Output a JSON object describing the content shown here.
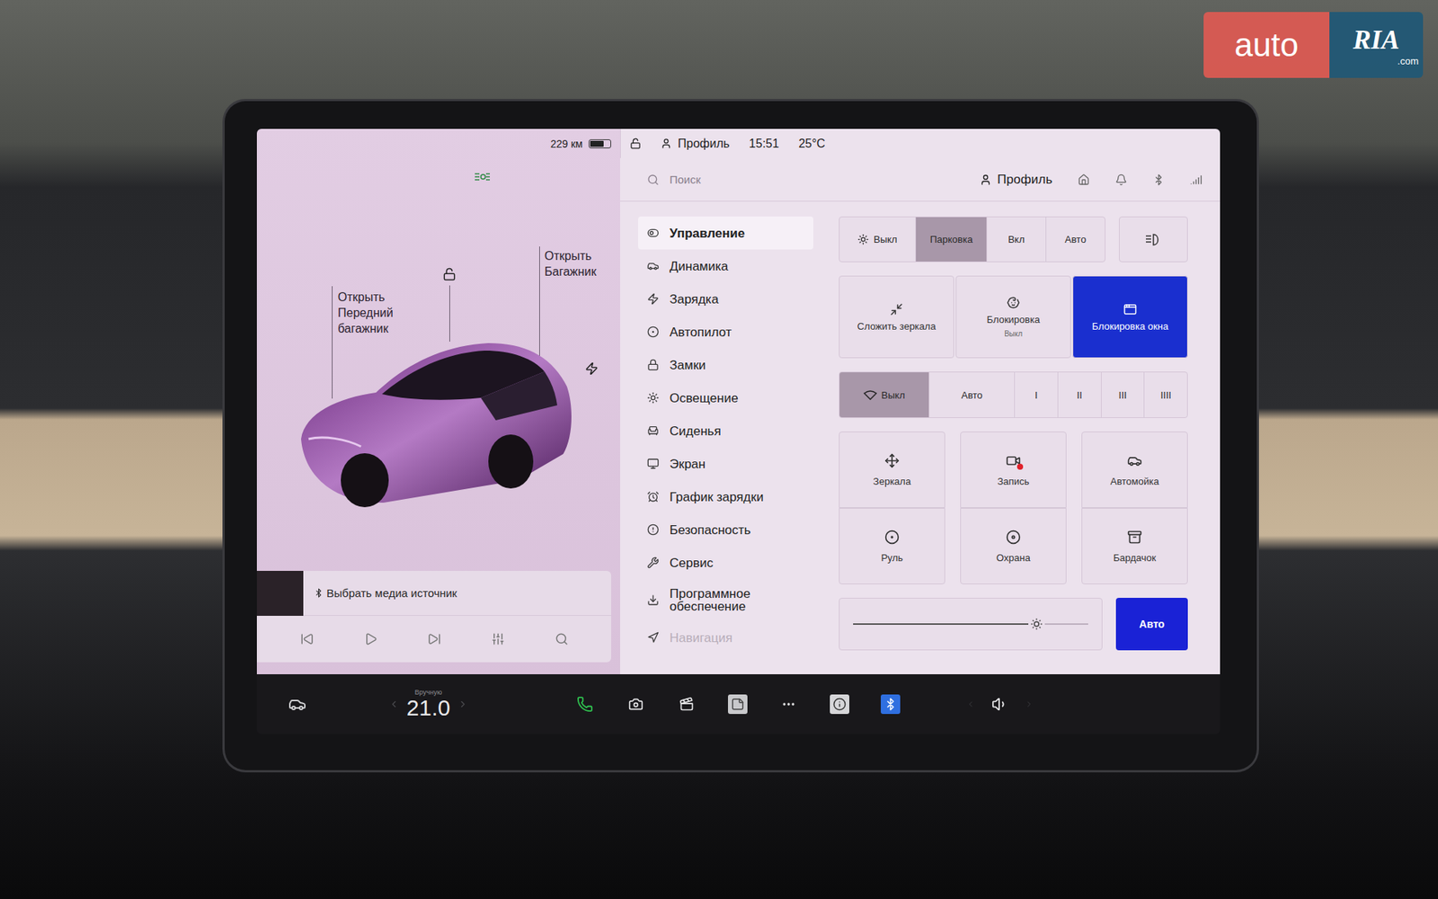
{
  "watermark": {
    "brand": "auto",
    "sub": "RIA",
    "domain": ".com"
  },
  "status_bar": {
    "range": "229 км",
    "battery_level": 0.7,
    "locked": false,
    "profile": "Профиль",
    "time": "15:51",
    "temperature": "25°C"
  },
  "car_view": {
    "front_trunk": [
      "Открыть",
      "Передний",
      "багажник"
    ],
    "trunk": [
      "Открыть",
      "Багажник"
    ],
    "locked": false
  },
  "media": {
    "source": "Выбрать медиа источник"
  },
  "search": {
    "placeholder": "Поиск",
    "profile": "Профиль"
  },
  "menu": [
    {
      "label": "Управление",
      "selected": true,
      "faded": false
    },
    {
      "label": "Динамика",
      "selected": false,
      "faded": false
    },
    {
      "label": "Зарядка",
      "selected": false,
      "faded": false
    },
    {
      "label": "Автопилот",
      "selected": false,
      "faded": false
    },
    {
      "label": "Замки",
      "selected": false,
      "faded": false
    },
    {
      "label": "Освещение",
      "selected": false,
      "faded": false
    },
    {
      "label": "Сиденья",
      "selected": false,
      "faded": false
    },
    {
      "label": "Экран",
      "selected": false,
      "faded": false
    },
    {
      "label": "График зарядки",
      "selected": false,
      "faded": false
    },
    {
      "label": "Безопасность",
      "selected": false,
      "faded": false
    },
    {
      "label": "Сервис",
      "selected": false,
      "faded": false
    },
    {
      "label": "Программное обеспечение",
      "selected": false,
      "faded": false
    },
    {
      "label": "Навигация",
      "selected": false,
      "faded": true
    }
  ],
  "lights": [
    {
      "label": "Выкл",
      "selected": false
    },
    {
      "label": "Парковка",
      "selected": true
    },
    {
      "label": "Вкл",
      "selected": false
    },
    {
      "label": "Авто",
      "selected": false
    }
  ],
  "tiles": [
    {
      "label": "Сложить зеркала",
      "selected": false
    },
    {
      "label": "Блокировка",
      "status": "Выкл",
      "selected": false
    },
    {
      "label": "Блокировка окна",
      "selected": true
    }
  ],
  "wipers": [
    {
      "label": "Выкл",
      "selected": true
    },
    {
      "label": "Авто",
      "selected": false
    },
    {
      "label": "I",
      "selected": false
    },
    {
      "label": "II",
      "selected": false
    },
    {
      "label": "III",
      "selected": false
    },
    {
      "label": "IIII",
      "selected": false
    }
  ],
  "quick_controls": [
    {
      "label": "Зеркала",
      "recording": false
    },
    {
      "label": "Запись",
      "recording": true
    },
    {
      "label": "Автомойка",
      "recording": false
    },
    {
      "label": "Руль",
      "recording": false
    },
    {
      "label": "Охрана",
      "recording": false
    },
    {
      "label": "Бардачок",
      "recording": false
    }
  ],
  "brightness": {
    "level": 0.78,
    "auto_label": "Авто",
    "auto": true
  },
  "climate": {
    "mode": "Вручную",
    "temperature": "21.0"
  }
}
